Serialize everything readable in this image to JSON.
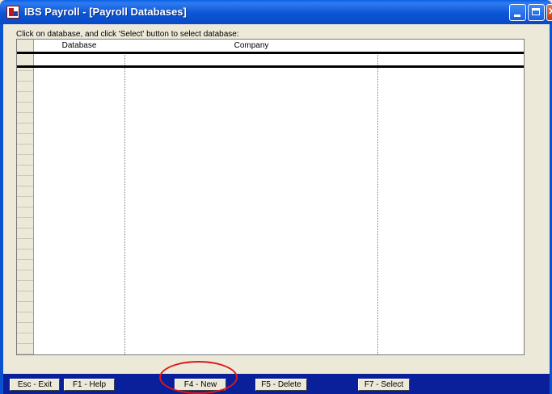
{
  "window": {
    "title": "IBS Payroll - [Payroll Databases]"
  },
  "instruction": "Click on database, and click 'Select' button to select database:",
  "grid": {
    "columns": [
      "Database",
      "Company",
      ""
    ]
  },
  "toolbar": {
    "exit_label": "Esc - Exit",
    "help_label": "F1 - Help",
    "new_label": "F4 - New",
    "delete_label": "F5 - Delete",
    "select_label": "F7 - Select"
  },
  "colors": {
    "titlebar": "#0b55d6",
    "toolbar": "#0a1f9a",
    "highlight_circle": "#e0161a"
  }
}
